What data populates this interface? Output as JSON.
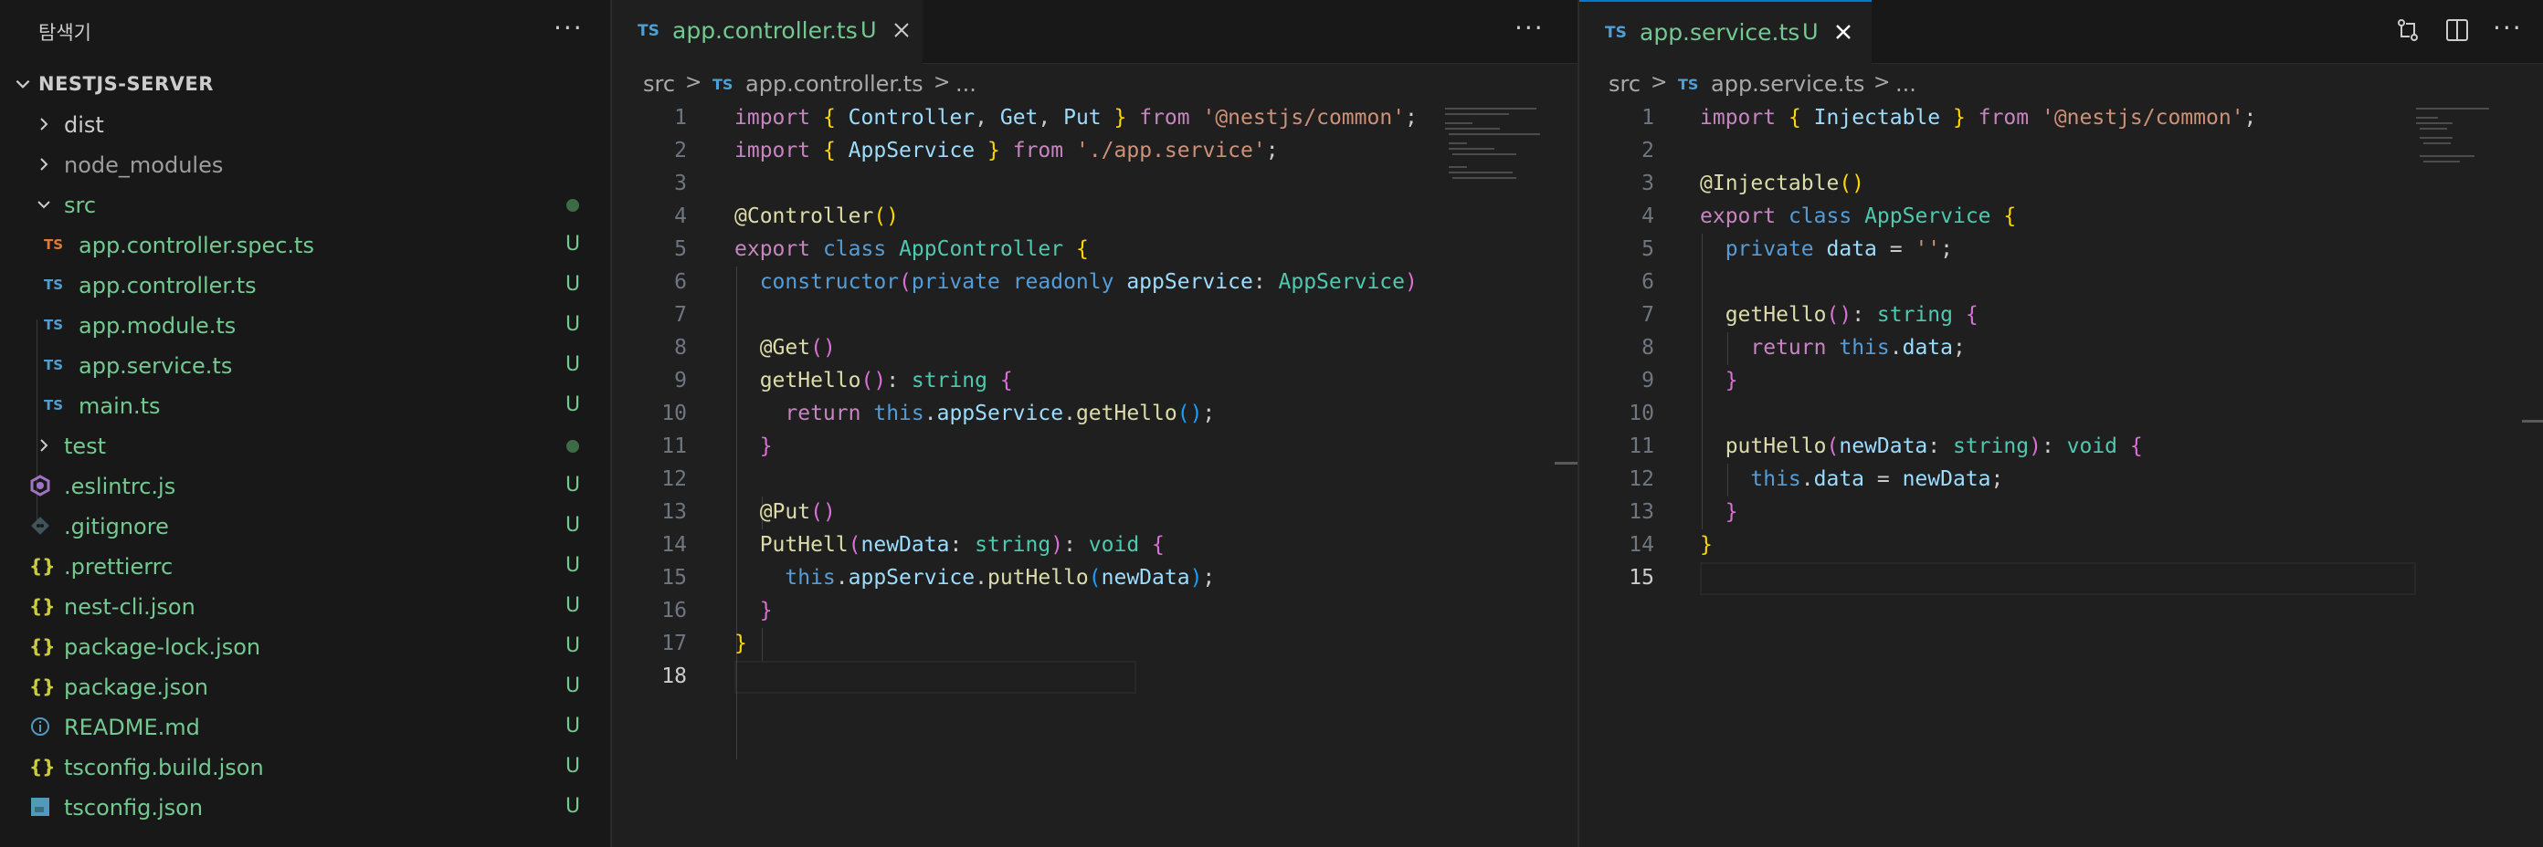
{
  "explorer": {
    "title": "탐색기",
    "more": "···",
    "project": "NESTJS-SERVER",
    "items": [
      {
        "name": "dist",
        "type": "folder",
        "status": ""
      },
      {
        "name": "node_modules",
        "type": "folder",
        "status": ""
      },
      {
        "name": "src",
        "type": "folder-open",
        "status": "dot"
      },
      {
        "name": "app.controller.spec.ts",
        "type": "ts-spec",
        "status": "U"
      },
      {
        "name": "app.controller.ts",
        "type": "ts",
        "status": "U"
      },
      {
        "name": "app.module.ts",
        "type": "ts",
        "status": "U"
      },
      {
        "name": "app.service.ts",
        "type": "ts",
        "status": "U"
      },
      {
        "name": "main.ts",
        "type": "ts",
        "status": "U"
      },
      {
        "name": "test",
        "type": "folder",
        "status": "dot"
      },
      {
        "name": ".eslintrc.js",
        "type": "eslint",
        "status": "U"
      },
      {
        "name": ".gitignore",
        "type": "git",
        "status": "U"
      },
      {
        "name": ".prettierrc",
        "type": "json",
        "status": "U"
      },
      {
        "name": "nest-cli.json",
        "type": "json",
        "status": "U"
      },
      {
        "name": "package-lock.json",
        "type": "json",
        "status": "U"
      },
      {
        "name": "package.json",
        "type": "json",
        "status": "U"
      },
      {
        "name": "README.md",
        "type": "info",
        "status": "U"
      },
      {
        "name": "tsconfig.build.json",
        "type": "json",
        "status": "U"
      },
      {
        "name": "tsconfig.json",
        "type": "tsconfig",
        "status": "U"
      }
    ]
  },
  "editor1": {
    "tab": {
      "badge": "TS",
      "name": "app.controller.ts",
      "status": "U"
    },
    "more": "···",
    "breadcrumb": {
      "folder": "src",
      "sep": ">",
      "badge": "TS",
      "file": "app.controller.ts",
      "sep2": ">",
      "rest": "..."
    },
    "active_line": 18,
    "lines": [
      "1",
      "2",
      "3",
      "4",
      "5",
      "6",
      "7",
      "8",
      "9",
      "10",
      "11",
      "12",
      "13",
      "14",
      "15",
      "16",
      "17",
      "18"
    ]
  },
  "editor2": {
    "tab": {
      "badge": "TS",
      "name": "app.service.ts",
      "status": "U"
    },
    "breadcrumb": {
      "folder": "src",
      "sep": ">",
      "badge": "TS",
      "file": "app.service.ts",
      "sep2": ">",
      "rest": "..."
    },
    "active_line": 15,
    "lines": [
      "1",
      "2",
      "3",
      "4",
      "5",
      "6",
      "7",
      "8",
      "9",
      "10",
      "11",
      "12",
      "13",
      "14",
      "15"
    ]
  },
  "icons": {
    "compare": "compare-changes-icon",
    "split": "split-editor-icon",
    "more": "more-actions-icon"
  },
  "colors": {
    "untracked": "#73c991",
    "ts_badge": "#4d9fd6",
    "accent": "#0078d4"
  }
}
